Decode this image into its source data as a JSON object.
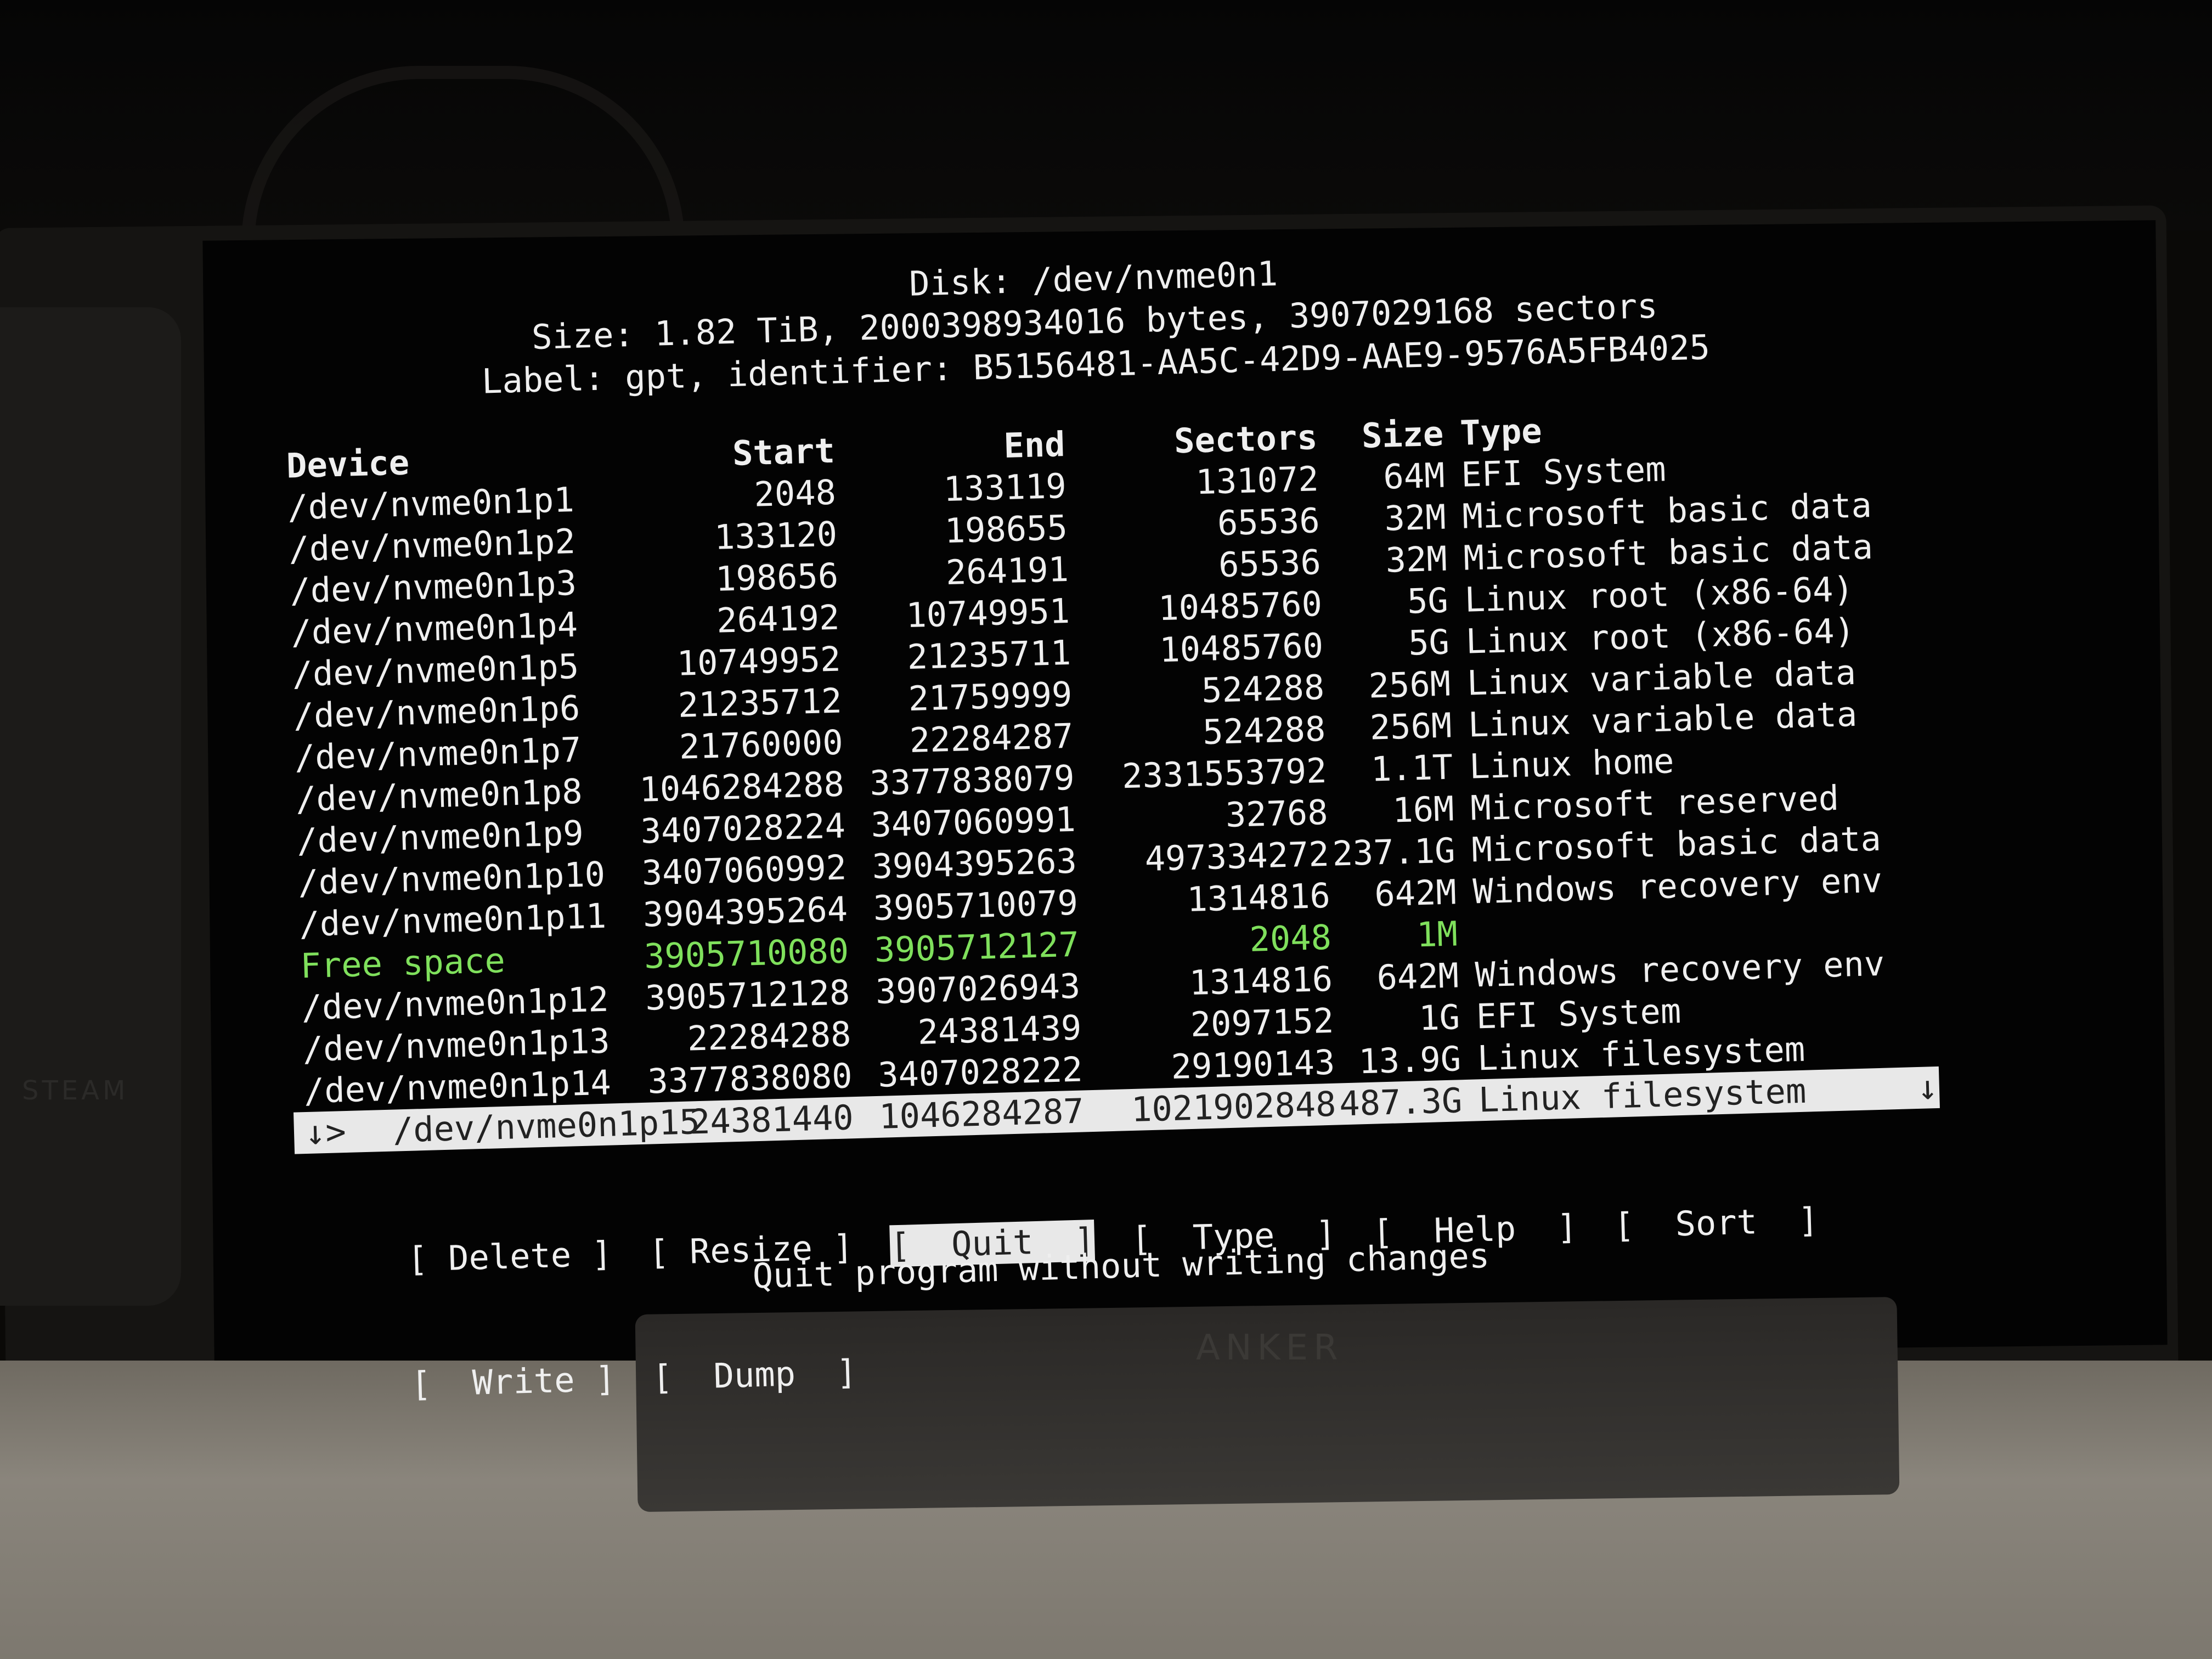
{
  "disk": {
    "title": "Disk: /dev/nvme0n1",
    "size_line": "Size: 1.82 TiB, 2000398934016 bytes, 3907029168 sectors",
    "label_line": "Label: gpt, identifier: B5156481-AA5C-42D9-AAE9-9576A5FB4025"
  },
  "table": {
    "headers": {
      "device": "Device",
      "start": "Start",
      "end": "End",
      "sectors": "Sectors",
      "size": "Size",
      "type": "Type"
    },
    "rows": [
      {
        "device": "/dev/nvme0n1p1",
        "start": "2048",
        "end": "133119",
        "sectors": "131072",
        "size": "64M",
        "type": "EFI System"
      },
      {
        "device": "/dev/nvme0n1p2",
        "start": "133120",
        "end": "198655",
        "sectors": "65536",
        "size": "32M",
        "type": "Microsoft basic data"
      },
      {
        "device": "/dev/nvme0n1p3",
        "start": "198656",
        "end": "264191",
        "sectors": "65536",
        "size": "32M",
        "type": "Microsoft basic data"
      },
      {
        "device": "/dev/nvme0n1p4",
        "start": "264192",
        "end": "10749951",
        "sectors": "10485760",
        "size": "5G",
        "type": "Linux root (x86-64)"
      },
      {
        "device": "/dev/nvme0n1p5",
        "start": "10749952",
        "end": "21235711",
        "sectors": "10485760",
        "size": "5G",
        "type": "Linux root (x86-64)"
      },
      {
        "device": "/dev/nvme0n1p6",
        "start": "21235712",
        "end": "21759999",
        "sectors": "524288",
        "size": "256M",
        "type": "Linux variable data"
      },
      {
        "device": "/dev/nvme0n1p7",
        "start": "21760000",
        "end": "22284287",
        "sectors": "524288",
        "size": "256M",
        "type": "Linux variable data"
      },
      {
        "device": "/dev/nvme0n1p8",
        "start": "1046284288",
        "end": "3377838079",
        "sectors": "2331553792",
        "size": "1.1T",
        "type": "Linux home"
      },
      {
        "device": "/dev/nvme0n1p9",
        "start": "3407028224",
        "end": "3407060991",
        "sectors": "32768",
        "size": "16M",
        "type": "Microsoft reserved"
      },
      {
        "device": "/dev/nvme0n1p10",
        "start": "3407060992",
        "end": "3904395263",
        "sectors": "497334272",
        "size": "237.1G",
        "type": "Microsoft basic data"
      },
      {
        "device": "/dev/nvme0n1p11",
        "start": "3904395264",
        "end": "3905710079",
        "sectors": "1314816",
        "size": "642M",
        "type": "Windows recovery env"
      },
      {
        "device": "Free space",
        "start": "3905710080",
        "end": "3905712127",
        "sectors": "2048",
        "size": "1M",
        "type": "",
        "free": true
      },
      {
        "device": "/dev/nvme0n1p12",
        "start": "3905712128",
        "end": "3907026943",
        "sectors": "1314816",
        "size": "642M",
        "type": "Windows recovery env"
      },
      {
        "device": "/dev/nvme0n1p13",
        "start": "22284288",
        "end": "24381439",
        "sectors": "2097152",
        "size": "1G",
        "type": "EFI System"
      },
      {
        "device": "/dev/nvme0n1p14",
        "start": "3377838080",
        "end": "3407028222",
        "sectors": "29190143",
        "size": "13.9G",
        "type": "Linux filesystem"
      }
    ],
    "selected": {
      "device": "/dev/nvme0n1p15",
      "start": "24381440",
      "end": "1046284287",
      "sectors": "1021902848",
      "size": "487.3G",
      "type": "Linux filesystem",
      "arrow_left": "↓>",
      "arrow_down": "↓"
    }
  },
  "menu": {
    "delete": "[ Delete ]",
    "resize": "[ Resize ]",
    "quit": "[  Quit  ]",
    "type": "[  Type  ]",
    "help": "[  Help  ]",
    "sort": "[  Sort  ]",
    "write": "[  Write ]",
    "dump": "[  Dump  ]"
  },
  "status": "Quit program without writing changes",
  "colors": {
    "terminal_text": "#efefef",
    "free_space": "#7fe05c",
    "selection_bg": "#e8e8e8",
    "background": "#030303"
  },
  "physical": {
    "side_device_brand": "STEAM",
    "stand_brand": "ANKER"
  }
}
